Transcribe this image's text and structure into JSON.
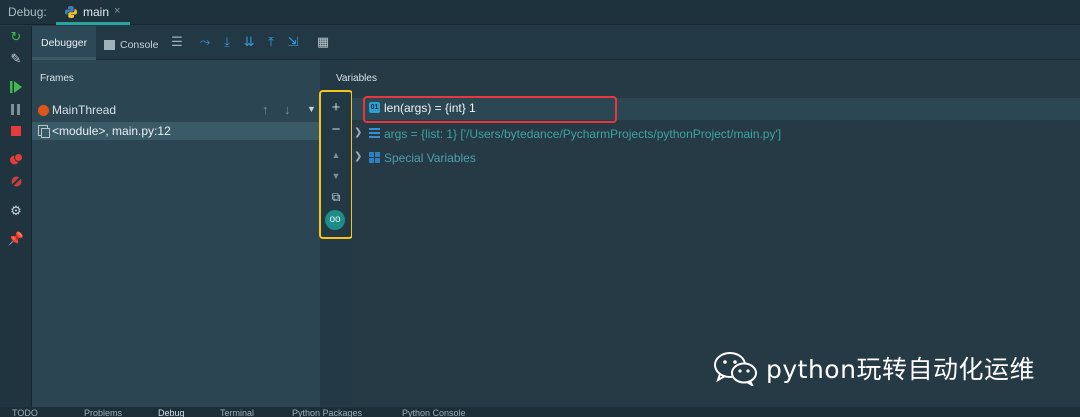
{
  "header": {
    "debug_label": "Debug:",
    "run_tab": {
      "label": "main",
      "icon": "python-icon",
      "close": "×"
    }
  },
  "toolbar": {
    "tabs": [
      {
        "label": "Debugger",
        "active": true
      },
      {
        "label": "Console",
        "icon": "console-icon"
      }
    ],
    "icons": [
      "layout-menu-icon",
      "show-execution-point-icon",
      "step-over-icon",
      "step-into-icon",
      "step-into-my-code-icon",
      "step-out-icon",
      "run-to-cursor-icon",
      "evaluate-expression-icon"
    ]
  },
  "gutter_icons": [
    "rerun-icon",
    "settings-wrench-icon",
    "resume-icon",
    "pause-icon",
    "stop-icon",
    "view-breakpoints-icon",
    "mute-breakpoints-icon",
    "gear-icon",
    "pin-icon"
  ],
  "frames": {
    "title": "Frames",
    "thread": "MainThread",
    "items": [
      "<module>, main.py:12"
    ]
  },
  "variables": {
    "title": "Variables",
    "watch": {
      "text": "len(args) = {int} 1",
      "icon_label": "01"
    },
    "rows": [
      {
        "name": "args",
        "text": "args = {list: 1} ['/Users/bytedance/PycharmProjects/pythonProject/main.py']"
      },
      {
        "name": "special",
        "text": "Special Variables"
      }
    ]
  },
  "side_toolbar": {
    "plus": "+",
    "minus": "−",
    "up": "▲",
    "down": "▼",
    "copy": "⧉",
    "glasses": "oo"
  },
  "watermark": {
    "text": "python玩转自动化运维"
  },
  "bottom_tabs": [
    "TODO",
    "Problems",
    "Debug",
    "Terminal",
    "Python Packages",
    "Python Console"
  ],
  "colors": {
    "accent_teal": "#2aa39b",
    "highlight_yellow": "#f5c518",
    "highlight_red": "#e8383d",
    "thread_orange": "#e0561a"
  }
}
